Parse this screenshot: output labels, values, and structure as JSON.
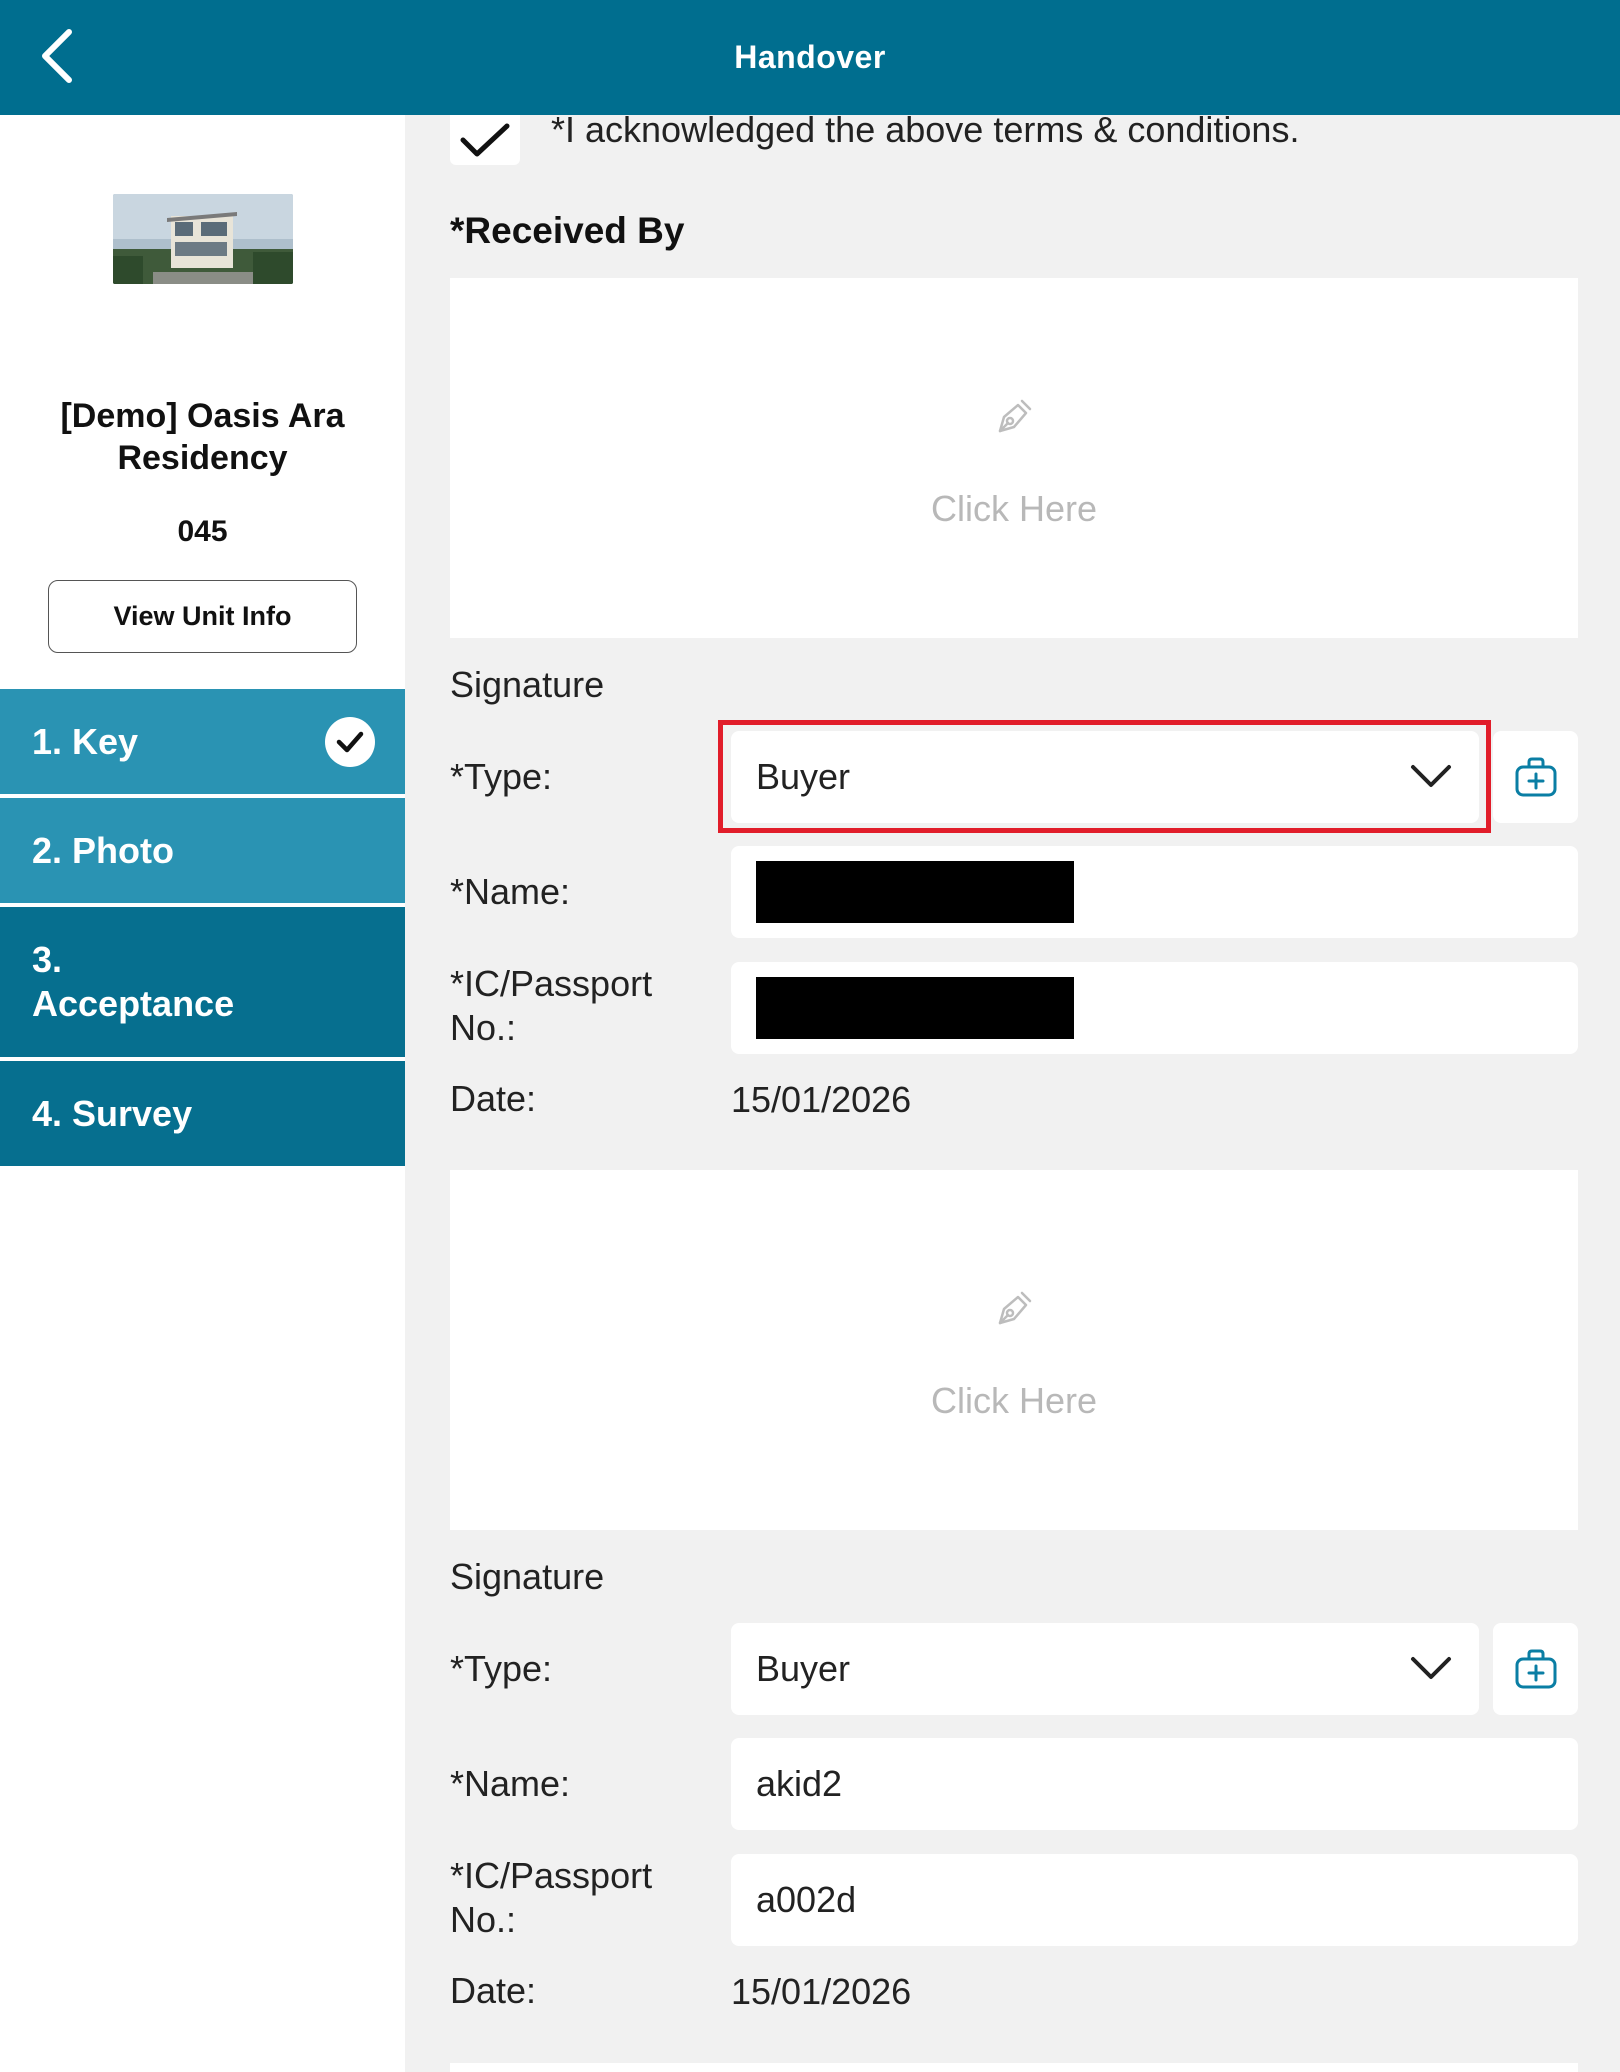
{
  "header": {
    "title": "Handover",
    "back_icon": "chevron-left-icon"
  },
  "sidebar": {
    "project_name": "[Demo] Oasis Ara Residency",
    "unit_no": "045",
    "view_unit_label": "View Unit Info",
    "steps": [
      {
        "label": "1. Key",
        "completed": true
      },
      {
        "label": "2. Photo",
        "completed": false
      },
      {
        "label": "3. Acceptance",
        "completed": false
      },
      {
        "label": "4. Survey",
        "completed": false
      }
    ]
  },
  "main": {
    "acknowledge_text": "*I acknowledged the above terms & conditions.",
    "acknowledge_checked": true,
    "received_by_label": "*Received By",
    "signatures": [
      {
        "pad_hint": "Click Here",
        "section_label": "Signature",
        "type_label": "*Type:",
        "type_value": "Buyer",
        "name_label": "*Name:",
        "name_value": "",
        "ic_label": "*IC/Passport No.:",
        "ic_value": "",
        "date_label": "Date:",
        "date_value": "15/01/2026"
      },
      {
        "pad_hint": "Click Here",
        "section_label": "Signature",
        "type_label": "*Type:",
        "type_value": "Buyer",
        "name_label": "*Name:",
        "name_value": "akid2",
        "ic_label": "*IC/Passport No.:",
        "ic_value": "a002d",
        "date_label": "Date:",
        "date_value": "15/01/2026"
      }
    ]
  },
  "colors": {
    "header": "#006e8f",
    "nav_light": "#2a93b3",
    "nav_dark": "#066f8f",
    "highlight": "#e11d2a",
    "accent_icon": "#0a7ea4"
  }
}
